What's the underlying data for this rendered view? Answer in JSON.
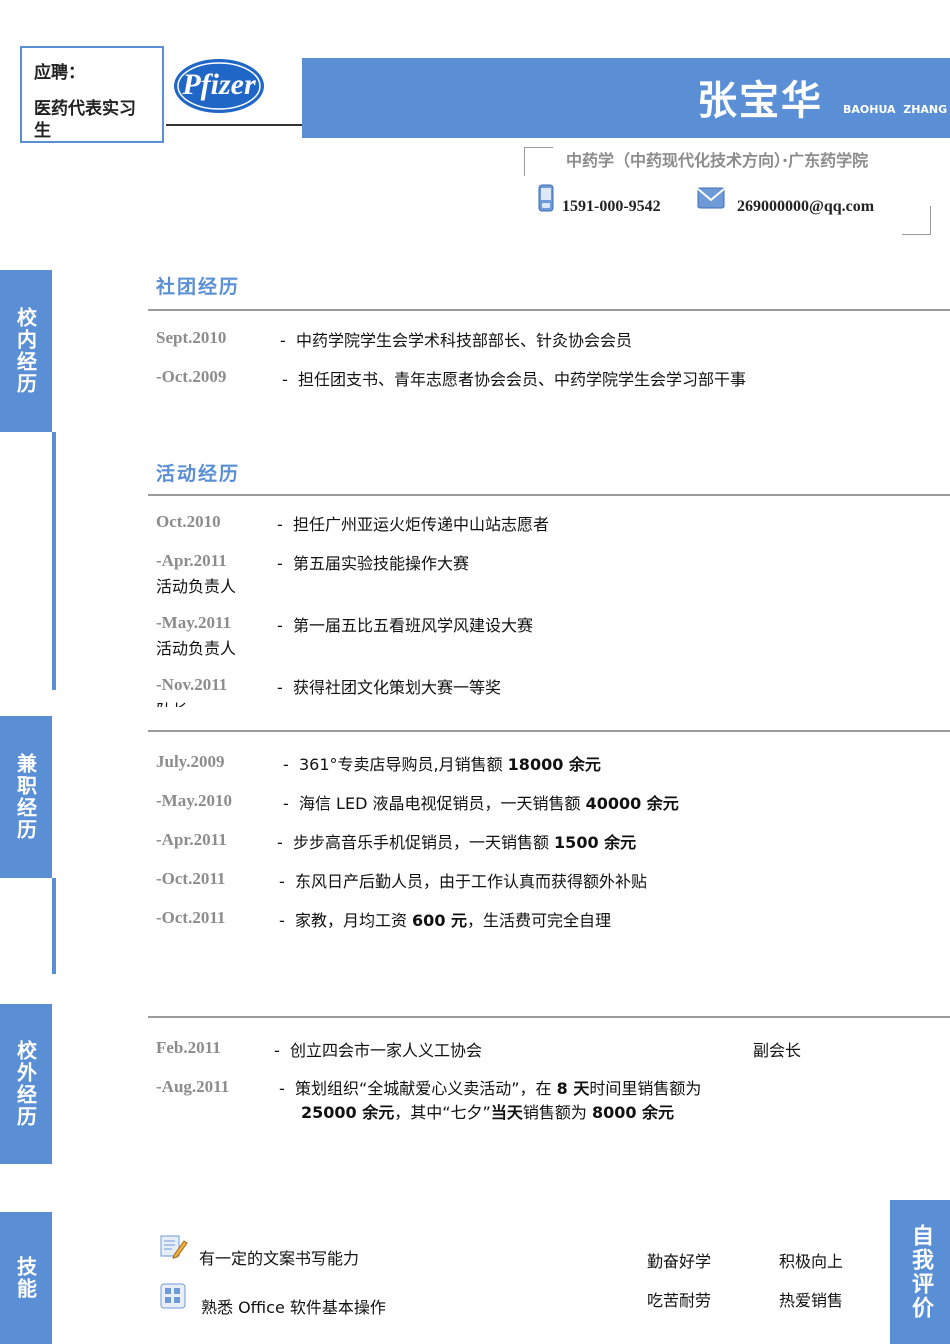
{
  "header": {
    "apply_label": "应聘：",
    "position": "医药代表实习生",
    "logo_text": "Pfizer",
    "name": "张宝华",
    "name_en": "BAOHUA  ZHANG",
    "school": "中药学（中药现代化技术方向）·广东药学院",
    "phone": "1591-000-9542",
    "email": "269000000@qq.com",
    "accent_color": "#5a8fd6"
  },
  "tabs": {
    "campus": "校内经历",
    "parttime": "兼职经历",
    "outside": "校外经历",
    "skills": "技能",
    "self": "自我评价"
  },
  "club": {
    "title": "社团经历",
    "rows": [
      {
        "date": "Sept.2010",
        "text": "中药学院学生会学术科技部部长、针灸协会会员"
      },
      {
        "date": "-Oct.2009",
        "text": "担任团支书、青年志愿者协会会员、中药学院学生会学习部干事"
      }
    ]
  },
  "activity": {
    "title": "活动经历",
    "rows": [
      {
        "date": "Oct.2010",
        "text": "担任广州亚运火炬传递中山站志愿者",
        "role": ""
      },
      {
        "date": "-Apr.2011",
        "text": "第五届实验技能操作大赛",
        "role": "活动负责人"
      },
      {
        "date": "-May.2011",
        "text": "第一届五比五看班风学风建设大赛",
        "role": "活动负责人"
      },
      {
        "date": "-Nov.2011",
        "text": "获得社团文化策划大赛一等奖",
        "role": "队长"
      }
    ]
  },
  "parttime": {
    "rows": [
      {
        "date": "July.2009",
        "pre": "361°专卖店导购员,月销售额 ",
        "bold": "18000 余元",
        "post": ""
      },
      {
        "date": "-May.2010",
        "pre": "海信 LED 液晶电视促销员，一天销售额 ",
        "bold": "40000 余元",
        "post": ""
      },
      {
        "date": "-Apr.2011",
        "pre": "步步高音乐手机促销员，一天销售额 ",
        "bold": "1500 余元",
        "post": ""
      },
      {
        "date": "-Oct.2011",
        "pre": "东风日产后勤人员，由于工作认真而获得额外补贴",
        "bold": "",
        "post": ""
      },
      {
        "date": "-Oct.2011",
        "pre": "家教，月均工资 ",
        "bold": "600 元",
        "post": "，生活费可完全自理"
      }
    ]
  },
  "outside": {
    "row1": {
      "date": "Feb.2011",
      "text": "创立四会市一家人义工协会",
      "role": "副会长"
    },
    "row2": {
      "date": "-Aug.2011",
      "l1_pre": "策划组织“全城献爱心义卖活动”，在 ",
      "l1_bold": "8 天",
      "l1_post": "时间里销售额为",
      "l2_bold1": "25000 余元",
      "l2_mid": "，其中“七夕”",
      "l2_bold2": "当天",
      "l2_mid2": "销售额为 ",
      "l2_bold3": "8000 余元"
    }
  },
  "skills": [
    {
      "icon": "edit-document-icon",
      "text": "有一定的文案书写能力"
    },
    {
      "icon": "office-software-icon",
      "text": "熟悉 Office 软件基本操作"
    }
  ],
  "self_eval": [
    "勤奋好学",
    "积极向上",
    "吃苦耐劳",
    "热爱销售"
  ]
}
